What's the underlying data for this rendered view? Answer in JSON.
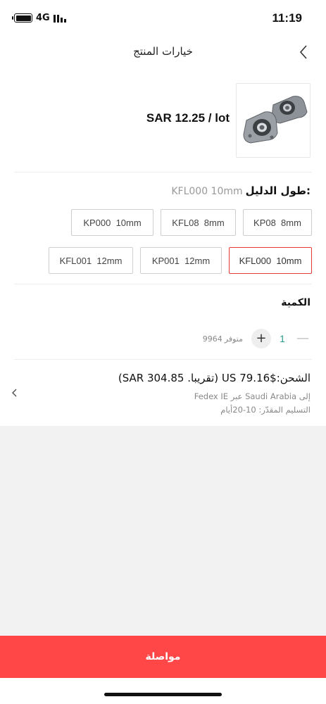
{
  "status_bar": {
    "network": "4G",
    "time": "11:19"
  },
  "header": {
    "title": "خيارات المنتج",
    "back_icon": "chevron-right-icon"
  },
  "product": {
    "price": "SAR 12.25 / lot",
    "image_icon": "pillow-block-bearing-image"
  },
  "options": {
    "label": "طول الدليل:",
    "selected_value": "KFL000  10mm",
    "rows": [
      [
        {
          "label": "KP08  8mm",
          "selected": false
        },
        {
          "label": "KFL08  8mm",
          "selected": false
        },
        {
          "label": "KP000  10mm",
          "selected": false
        }
      ],
      [
        {
          "label": "KFL000  10mm",
          "selected": true
        },
        {
          "label": "KP001  12mm",
          "selected": false
        },
        {
          "label": "KFL001  12mm",
          "selected": false
        }
      ]
    ]
  },
  "quantity": {
    "label": "الكمية",
    "value": "1",
    "minus": "—",
    "plus": "+",
    "stock_count": "9964",
    "stock_text": "متوفر"
  },
  "shipping": {
    "main": "الشحن:$79.16 US (تقريبا. SAR 304.85)",
    "destination": "إلى Saudi Arabia عبر Fedex IE",
    "delivery": "التسليم المقدّر: 10-20أيام"
  },
  "continue_label": "مواصلة",
  "colors": {
    "accent": "#ff4747",
    "selected_border": "#e53935",
    "quantity_value": "#2a9d8f"
  }
}
